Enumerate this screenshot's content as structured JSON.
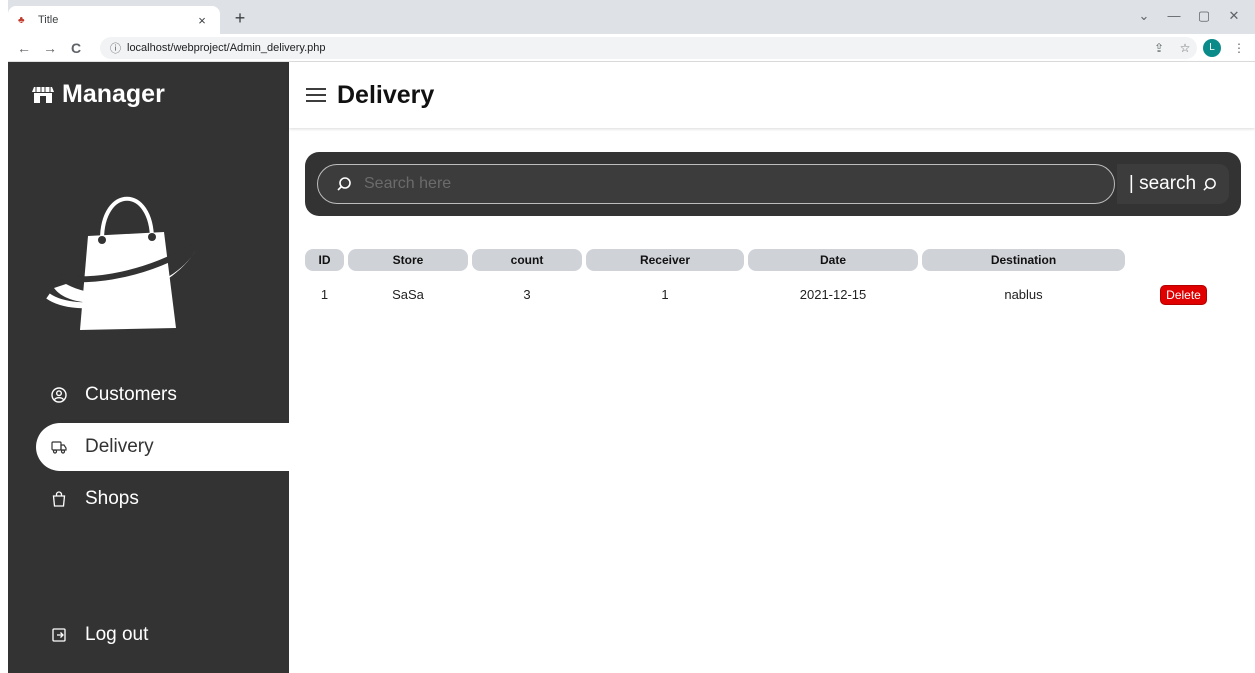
{
  "browser": {
    "tab_title": "Title",
    "tab_close": "×",
    "new_tab": "+",
    "url": "localhost/webproject/Admin_delivery.php",
    "profile_initial": "L",
    "back": "←",
    "forward": "→",
    "reload": "C",
    "info": "ⓘ",
    "share": "⇪",
    "star": "☆",
    "menu": "⋮",
    "minimize": "—",
    "restore": "▢",
    "close": "✕",
    "tabs_dropdown": "⌄"
  },
  "sidebar": {
    "brand": "Manager",
    "items": [
      {
        "label": "Customers",
        "icon": "user-circle-icon",
        "active": false
      },
      {
        "label": "Delivery",
        "icon": "truck-icon",
        "active": true
      },
      {
        "label": "Shops",
        "icon": "shopping-bag-icon",
        "active": false
      }
    ],
    "logout_label": "Log out"
  },
  "header": {
    "title": "Delivery"
  },
  "search": {
    "placeholder": "Search here",
    "button_label": "| search"
  },
  "table": {
    "columns": [
      "ID",
      "Store",
      "count",
      "Receiver",
      "Date",
      "Destination"
    ],
    "rows": [
      {
        "id": "1",
        "store": "SaSa",
        "count": "3",
        "receiver": "1",
        "date": "2021-12-15",
        "destination": "nablus",
        "action": "Delete"
      }
    ]
  },
  "colors": {
    "sidebar_bg": "#333333",
    "delete_red": "#e00000",
    "header_cell": "#cfd3d8"
  }
}
